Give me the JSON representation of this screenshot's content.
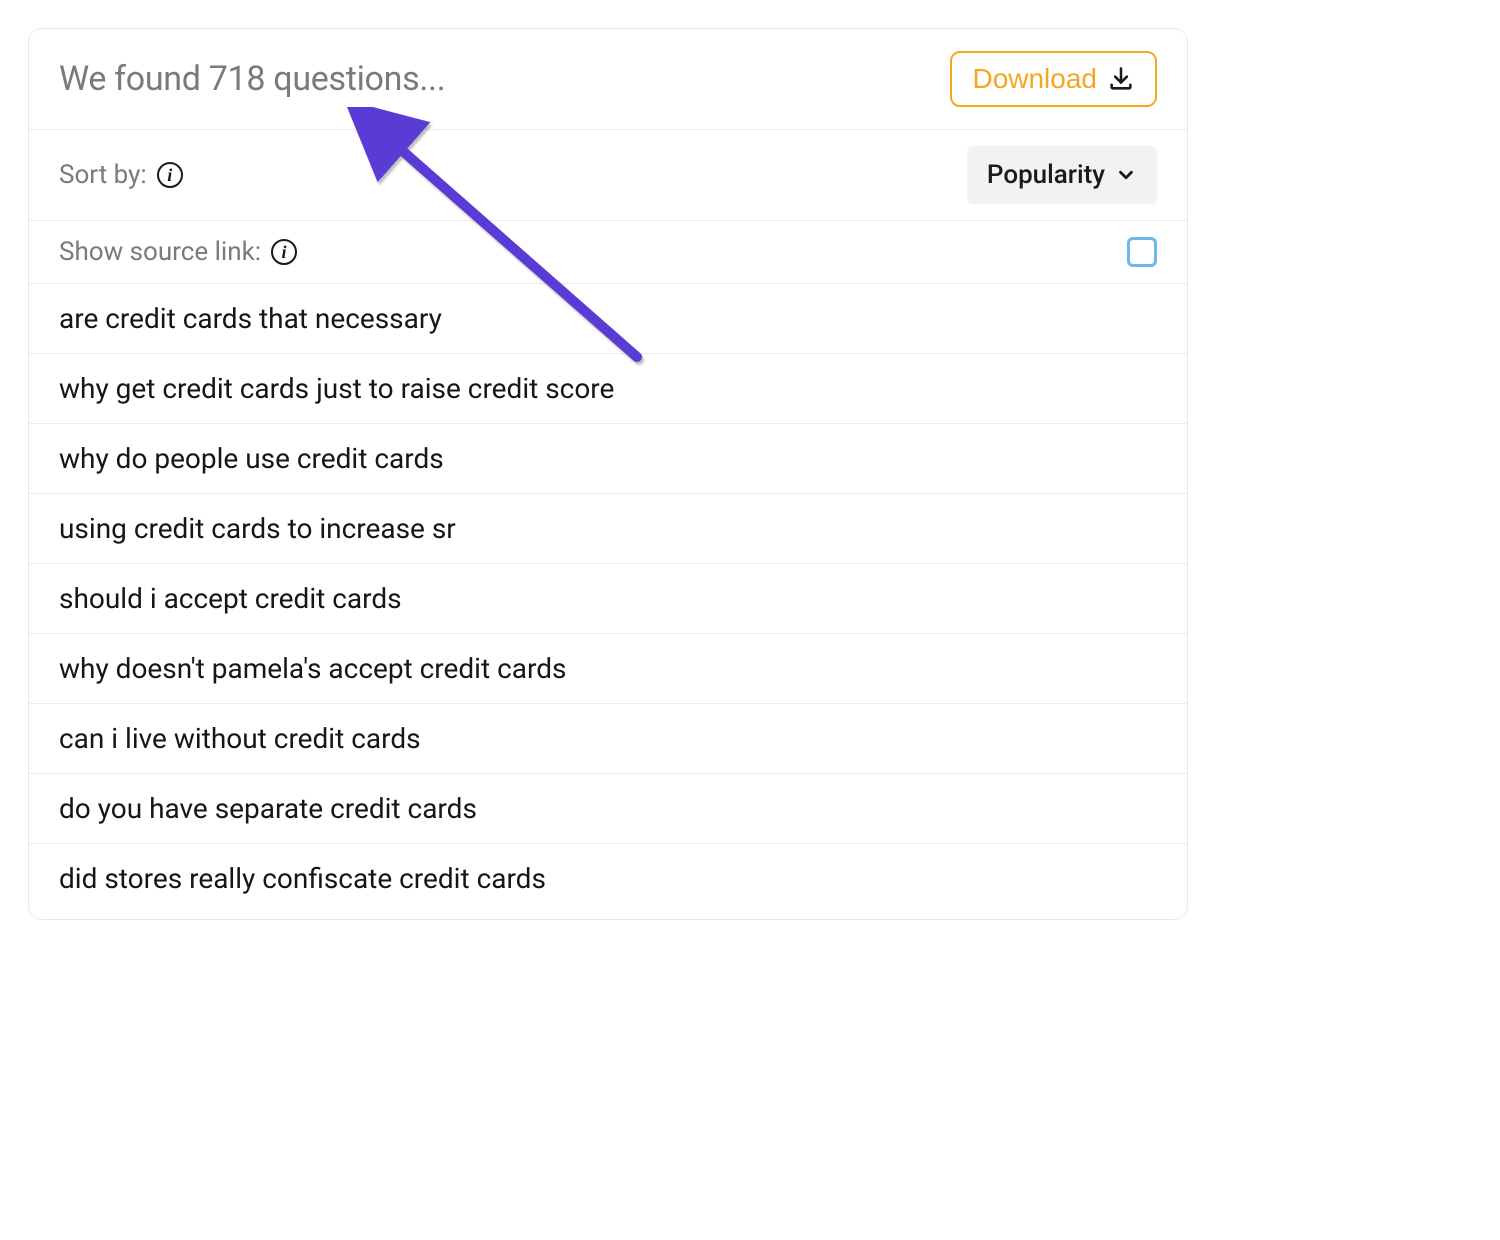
{
  "header": {
    "title": "We found 718 questions...",
    "download_label": "Download"
  },
  "controls": {
    "sort_label": "Sort by:",
    "sort_value": "Popularity",
    "source_link_label": "Show source link:"
  },
  "questions": [
    "are credit cards that necessary",
    "why get credit cards just to raise credit score",
    "why do people use credit cards",
    "using credit cards to increase sr",
    "should i accept credit cards",
    "why doesn't pamela's accept credit cards",
    "can i live without credit cards",
    "do you have separate credit cards",
    "did stores really confiscate credit cards"
  ]
}
